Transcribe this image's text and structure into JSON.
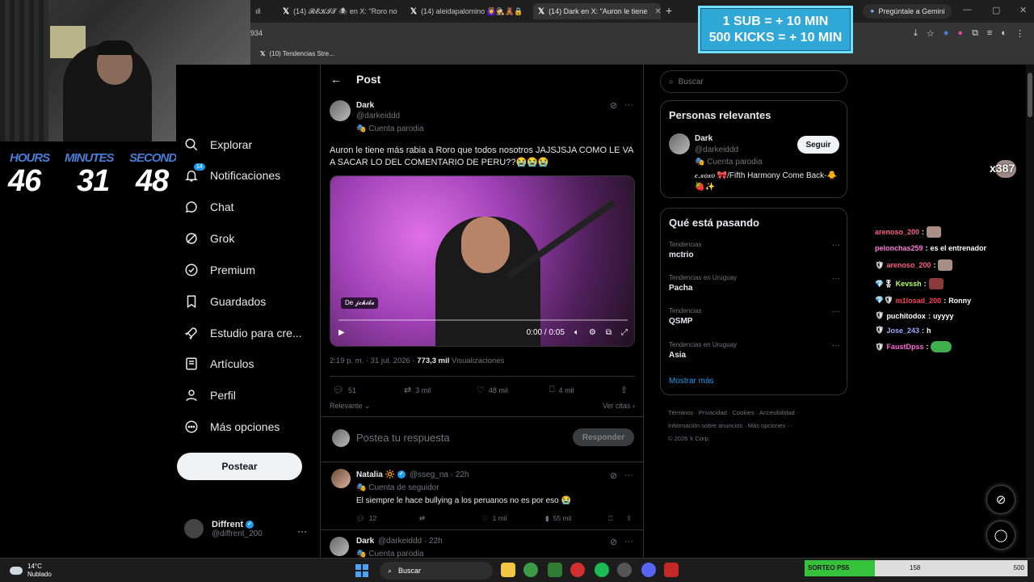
{
  "browser": {
    "tabs": [
      {
        "label": "ıll",
        "partial": true
      },
      {
        "label": "(14) 𝓡𝓔𝓚𝓘𝓣 🕷 en X: \"Roro no",
        "partial": true
      },
      {
        "label": "(14) aleidapalomino 🙆‍♀️🕵️🧸🔒"
      },
      {
        "label": "(14) Dark en X: \"Auron le tiene",
        "active": true
      }
    ],
    "gemini_label": "Pregúntale a Gemini",
    "url_fragment": "934",
    "bookmark": "(10) Tendencias Stre..."
  },
  "stream_overlay": {
    "timer": {
      "hours_label": "HOURS",
      "hours": "46",
      "minutes_label": "MINUTES",
      "minutes": "31",
      "seconds_label": "SECONDS",
      "seconds": "48"
    },
    "sub_banner": {
      "line1": "1 SUB = + 10 MIN",
      "line2": "500 KICKS = + 10 MIN"
    },
    "viewer_count": "x387",
    "chat": [
      {
        "user": "arenoso_200",
        "text": "",
        "color": "#ff5c8a",
        "emote": "face",
        "partial": true
      },
      {
        "user": "pelonchas259",
        "text": "es el entrenador",
        "color": "#ff7ad9"
      },
      {
        "user": "arenoso_200",
        "text": "",
        "color": "#ff5c8a",
        "emote": "face"
      },
      {
        "user": "Kevssh",
        "text": "",
        "color": "#b7ff5c",
        "emote": "red"
      },
      {
        "user": "m1losad_200",
        "text": "Ronny",
        "color": "#ff3b5c"
      },
      {
        "user": "puchitodox",
        "text": "uyyyy",
        "color": "#ffffff"
      },
      {
        "user": "Jose_243",
        "text": "h",
        "color": "#9aa9ff"
      },
      {
        "user": "FaustDpss",
        "text": "",
        "color": "#ff6ad5",
        "emote": "pepe"
      }
    ],
    "sorteo": {
      "label": "SORTEO PS5",
      "current": "158",
      "max": "500",
      "progress": 0.316
    }
  },
  "nav": {
    "items": [
      {
        "label": "Explorar",
        "icon": "search-icon"
      },
      {
        "label": "Notificaciones",
        "icon": "bell-icon",
        "badge": "14"
      },
      {
        "label": "Chat",
        "icon": "chat-icon"
      },
      {
        "label": "Grok",
        "icon": "grok-icon"
      },
      {
        "label": "Premium",
        "icon": "premium-icon"
      },
      {
        "label": "Guardados",
        "icon": "bookmark-icon"
      },
      {
        "label": "Estudio para cre...",
        "icon": "rocket-icon"
      },
      {
        "label": "Artículos",
        "icon": "article-icon"
      },
      {
        "label": "Perfil",
        "icon": "person-icon"
      },
      {
        "label": "Más opciones",
        "icon": "more-circle-icon"
      }
    ],
    "post_button": "Postear",
    "account": {
      "name": "Diffrent",
      "handle": "@diffrent_200"
    }
  },
  "post": {
    "header": "Post",
    "author": {
      "name": "Dark",
      "handle": "@darkeiddd",
      "label": "Cuenta parodia"
    },
    "text": "Auron le tiene más rabia a Roro que todos nosotros JAJSJSJA COMO LE VA A SACAR LO DEL COMENTARIO DE PERU??😭😭😭",
    "video": {
      "source_label": "De",
      "source_name": "𝓳𝓬𝓱𝓲𝓫𝓮",
      "time": "0:00 / 0:05"
    },
    "meta": {
      "time": "2:19 p. m. · 31 jul. 2026 · ",
      "views": "773,3 mil",
      "views_label": " Visualizaciones"
    },
    "stats": {
      "replies": "51",
      "reposts": "3 mil",
      "likes": "48 mil",
      "bookmarks": "4 mil"
    },
    "sort": "Relevante",
    "quotes": "Ver citas",
    "reply_placeholder": "Postea tu respuesta",
    "reply_button": "Responder"
  },
  "comments": [
    {
      "name": "Natalia",
      "name_suffix": "🔆",
      "handle": "@sseg_na · 22h",
      "label": "Cuenta de seguidor",
      "text": "El siempre le hace bullying a los peruanos no es por eso 😭",
      "stats": {
        "replies": "12",
        "likes": "1 mil",
        "views": "55 mil"
      }
    },
    {
      "name": "Dark",
      "handle": "@darkeiddd · 22h",
      "label": "Cuenta parodia"
    }
  ],
  "sidebar": {
    "search_placeholder": "Buscar",
    "relevant": {
      "title": "Personas relevantes",
      "name": "Dark",
      "handle": "@darkeiddd",
      "label": "Cuenta parodia",
      "bio": "𝒸.𝓍𝑜𝓍𝑜 🎀/Fifth Harmony Come Back-🐥🍓✨",
      "follow": "Seguir"
    },
    "trends": {
      "title": "Qué está pasando",
      "items": [
        {
          "context": "Tendencias",
          "name": "mctrio"
        },
        {
          "context": "Tendencias en Uruguay",
          "name": "Pacha"
        },
        {
          "context": "Tendencias",
          "name": "QSMP"
        },
        {
          "context": "Tendencias en Uruguay",
          "name": "Asia"
        }
      ],
      "show_more": "Mostrar más"
    },
    "footer": {
      "line1": "Términos · Privacidad · Cookies · Accesibilidad ·",
      "line2": "Información sobre anuncios · Más opciones ···",
      "line3": "© 2026 X Corp."
    }
  },
  "taskbar": {
    "temp": "14°C",
    "condition": "Nublado",
    "search": "Buscar"
  }
}
